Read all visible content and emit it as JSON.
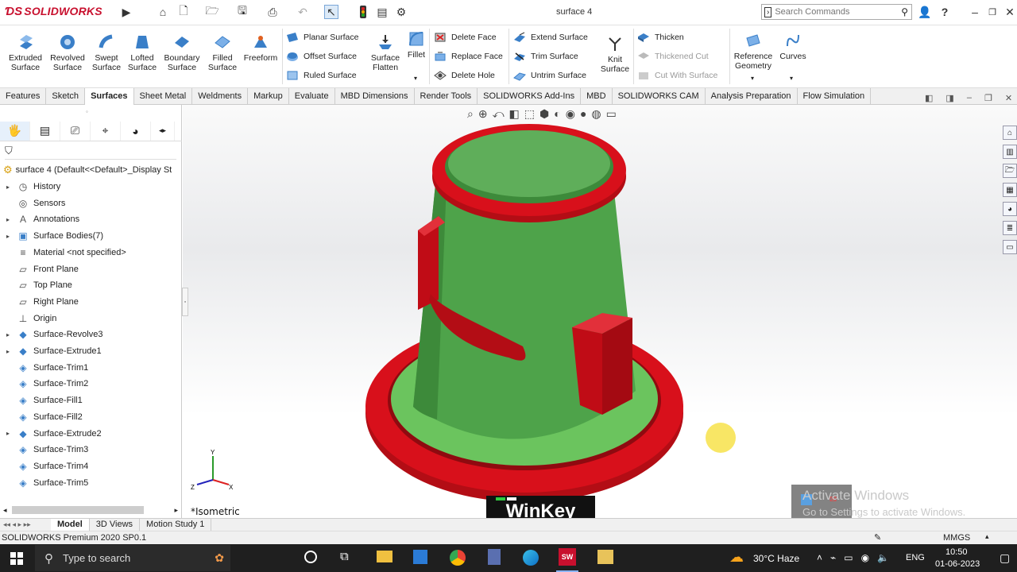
{
  "app": {
    "logo_text": "SOLIDWORKS",
    "doc_title": "surface 4",
    "search_placeholder": "Search Commands",
    "help_label": "?"
  },
  "ribbon": {
    "big_buttons": [
      {
        "label1": "Extruded",
        "label2": "Surface"
      },
      {
        "label1": "Revolved",
        "label2": "Surface"
      },
      {
        "label1": "Swept",
        "label2": "Surface"
      },
      {
        "label1": "Lofted",
        "label2": "Surface"
      },
      {
        "label1": "Boundary",
        "label2": "Surface"
      },
      {
        "label1": "Filled",
        "label2": "Surface"
      },
      {
        "label1": "Freeform",
        "label2": ""
      }
    ],
    "col1": [
      "Planar Surface",
      "Offset Surface",
      "Ruled Surface"
    ],
    "flatten": {
      "label1": "Surface",
      "label2": "Flatten"
    },
    "fillet": "Fillet",
    "col2": [
      "Delete Face",
      "Replace Face",
      "Delete Hole"
    ],
    "col3": [
      "Extend Surface",
      "Trim Surface",
      "Untrim Surface"
    ],
    "knit": {
      "label1": "Knit",
      "label2": "Surface"
    },
    "col4": [
      "Thicken",
      "Thickened Cut",
      "Cut With Surface"
    ],
    "refgeom": {
      "label1": "Reference",
      "label2": "Geometry"
    },
    "curves": "Curves"
  },
  "tabs": [
    "Features",
    "Sketch",
    "Surfaces",
    "Sheet Metal",
    "Weldments",
    "Markup",
    "Evaluate",
    "MBD Dimensions",
    "Render Tools",
    "SOLIDWORKS Add-Ins",
    "MBD",
    "SOLIDWORKS CAM",
    "Analysis Preparation",
    "Flow Simulation"
  ],
  "active_tab": "Surfaces",
  "tree": {
    "root": "surface 4  (Default<<Default>_Display St",
    "items": [
      {
        "label": "History",
        "expand": true,
        "icon": "history-icon"
      },
      {
        "label": "Sensors",
        "expand": false,
        "icon": "sensor-icon"
      },
      {
        "label": "Annotations",
        "expand": true,
        "icon": "annotation-icon"
      },
      {
        "label": "Surface Bodies(7)",
        "expand": true,
        "icon": "folder-icon"
      },
      {
        "label": "Material <not specified>",
        "expand": false,
        "icon": "material-icon"
      },
      {
        "label": "Front Plane",
        "expand": false,
        "icon": "plane-icon"
      },
      {
        "label": "Top Plane",
        "expand": false,
        "icon": "plane-icon"
      },
      {
        "label": "Right Plane",
        "expand": false,
        "icon": "plane-icon"
      },
      {
        "label": "Origin",
        "expand": false,
        "icon": "origin-icon"
      },
      {
        "label": "Surface-Revolve3",
        "expand": true,
        "icon": "surface-icon"
      },
      {
        "label": "Surface-Extrude1",
        "expand": true,
        "icon": "surface-icon"
      },
      {
        "label": "Surface-Trim1",
        "expand": false,
        "icon": "trim-icon"
      },
      {
        "label": "Surface-Trim2",
        "expand": false,
        "icon": "trim-icon"
      },
      {
        "label": "Surface-Fill1",
        "expand": false,
        "icon": "trim-icon"
      },
      {
        "label": "Surface-Fill2",
        "expand": false,
        "icon": "trim-icon"
      },
      {
        "label": "Surface-Extrude2",
        "expand": true,
        "icon": "surface-icon"
      },
      {
        "label": "Surface-Trim3",
        "expand": false,
        "icon": "trim-icon"
      },
      {
        "label": "Surface-Trim4",
        "expand": false,
        "icon": "trim-icon"
      },
      {
        "label": "Surface-Trim5",
        "expand": false,
        "icon": "trim-icon"
      }
    ]
  },
  "viewport": {
    "view_label": "*Isometric",
    "overlay_key": "WinKey",
    "activate_line1": "Activate Windows",
    "activate_line2": "Go to Settings to activate Windows.",
    "triad": {
      "x": "X",
      "y": "Y",
      "z": "Z"
    }
  },
  "bottom_tabs": [
    "Model",
    "3D Views",
    "Motion Study 1"
  ],
  "status": {
    "left": "SOLIDWORKS Premium 2020 SP0.1",
    "units": "MMGS"
  },
  "taskbar": {
    "search_placeholder": "Type to search",
    "weather": "30°C  Haze",
    "lang": "ENG",
    "time": "10:50",
    "date": "01-06-2023"
  },
  "colors": {
    "red_part": "#d8101b",
    "green_part": "#4ea34a",
    "light_green": "#6bc45e",
    "accent": "#c8102e"
  }
}
